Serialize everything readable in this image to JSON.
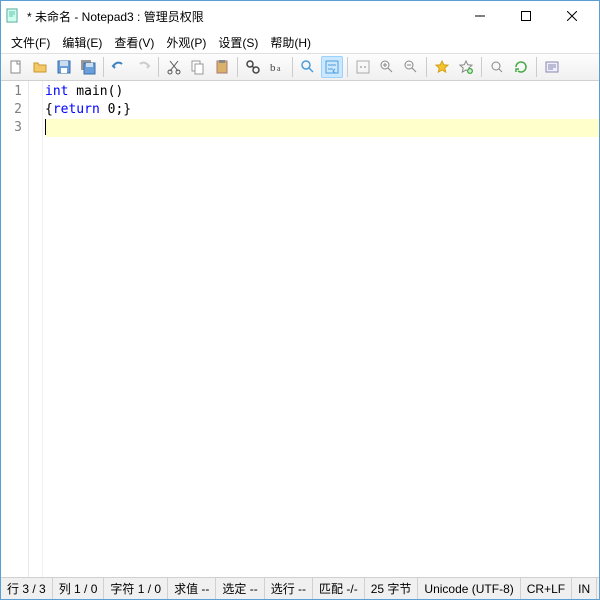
{
  "title": "* 未命名 - Notepad3 : 管理员权限",
  "menu": {
    "file": "文件(F)",
    "edit": "编辑(E)",
    "view": "查看(V)",
    "appearance": "外观(P)",
    "settings": "设置(S)",
    "help": "帮助(H)"
  },
  "code": {
    "lines": [
      "1",
      "2",
      "3"
    ],
    "l1_kw": "int",
    "l1_rest": " main()",
    "l2_a": "{",
    "l2_kw": "return",
    "l2_b": " 0;}"
  },
  "status": {
    "line": "行 3 / 3",
    "col": "列 1 / 0",
    "char": "字符 1 / 0",
    "eval": "求值 --",
    "sel": "选定 --",
    "sellines": "选行 --",
    "match": "匹配 -/-",
    "bytes": "25 字节",
    "encoding": "Unicode (UTF-8)",
    "eol": "CR+LF",
    "mode": "IN"
  }
}
